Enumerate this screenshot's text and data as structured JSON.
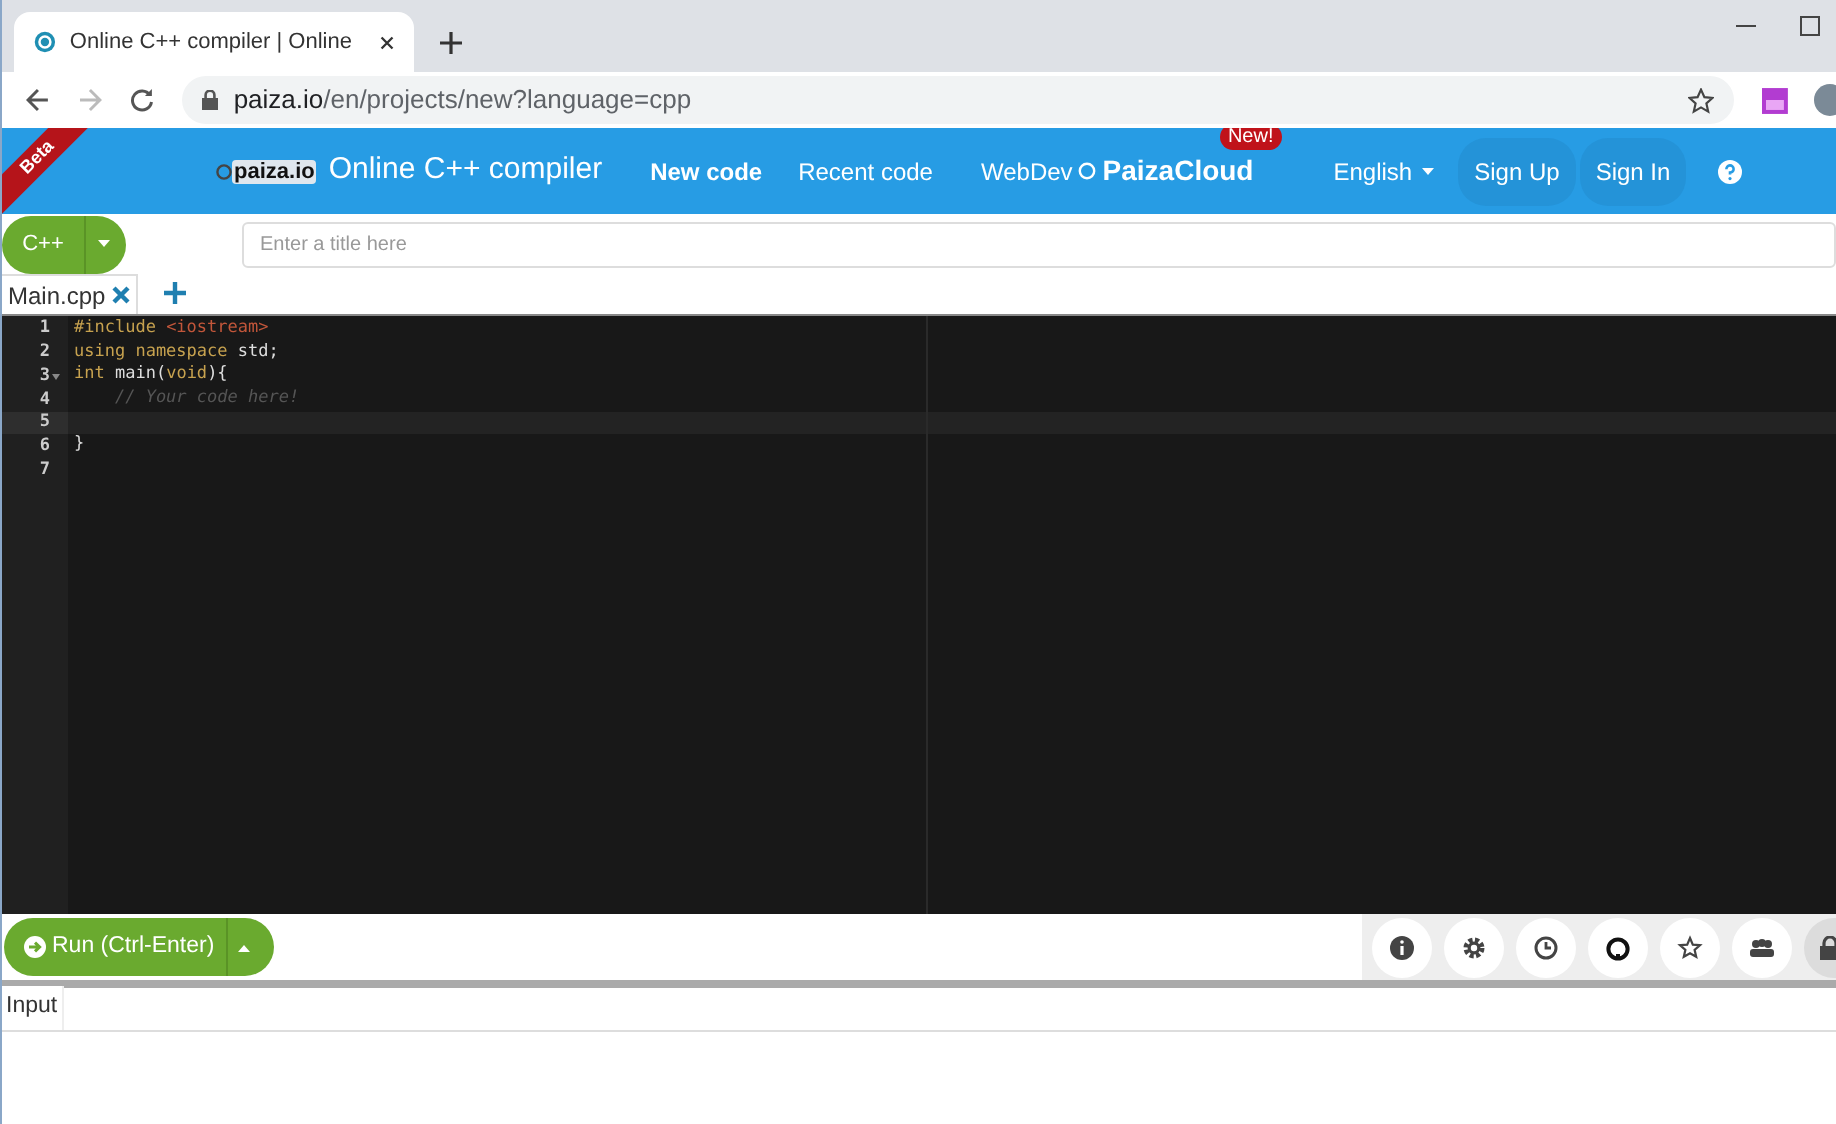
{
  "browser": {
    "tab_title": "Online C++ compiler | Online ",
    "url_host": "paiza.io",
    "url_path": "/en/projects/new?language=cpp"
  },
  "header": {
    "ribbon": "Beta",
    "logo": "paiza.io",
    "title": "Online C++ compiler",
    "nav": [
      {
        "label": "New code",
        "selected": true
      },
      {
        "label": "Recent code",
        "selected": false
      }
    ],
    "webdev": "WebDev",
    "cloud": "PaizaCloud",
    "cloud_badge": "New!",
    "language": "English",
    "buttons": [
      "Sign Up",
      "Sign In"
    ]
  },
  "toolbar": {
    "language": "C++",
    "title_placeholder": "Enter a title here"
  },
  "file_tabs": [
    {
      "label": "Main.cpp",
      "selected": true
    }
  ],
  "editor": {
    "lines": [
      {
        "number": "1",
        "active": false,
        "foldable": false,
        "tokens": [
          {
            "text": "#include ",
            "kind": "include"
          },
          {
            "text": "<iostream>",
            "kind": "string"
          }
        ]
      },
      {
        "number": "2",
        "active": false,
        "foldable": false,
        "tokens": [
          {
            "text": "using namespace ",
            "kind": "include"
          },
          {
            "text": "std;",
            "kind": "plain"
          }
        ]
      },
      {
        "number": "3",
        "active": false,
        "foldable": true,
        "tokens": [
          {
            "text": "int ",
            "kind": "include"
          },
          {
            "text": "main(",
            "kind": "plain"
          },
          {
            "text": "void",
            "kind": "include"
          },
          {
            "text": "){",
            "kind": "plain"
          }
        ]
      },
      {
        "number": "4",
        "active": false,
        "foldable": false,
        "tokens": [
          {
            "text": "    // Your code here!",
            "kind": "comment"
          }
        ]
      },
      {
        "number": "5",
        "active": true,
        "foldable": false
      },
      {
        "number": "6",
        "active": false,
        "foldable": false,
        "tokens": [
          {
            "text": "}",
            "kind": "plain"
          }
        ]
      },
      {
        "number": "7",
        "active": false,
        "foldable": false
      }
    ]
  },
  "run_button": "Run (Ctrl-Enter)",
  "io_tabs": [
    {
      "label": "Input",
      "selected": true
    }
  ]
}
